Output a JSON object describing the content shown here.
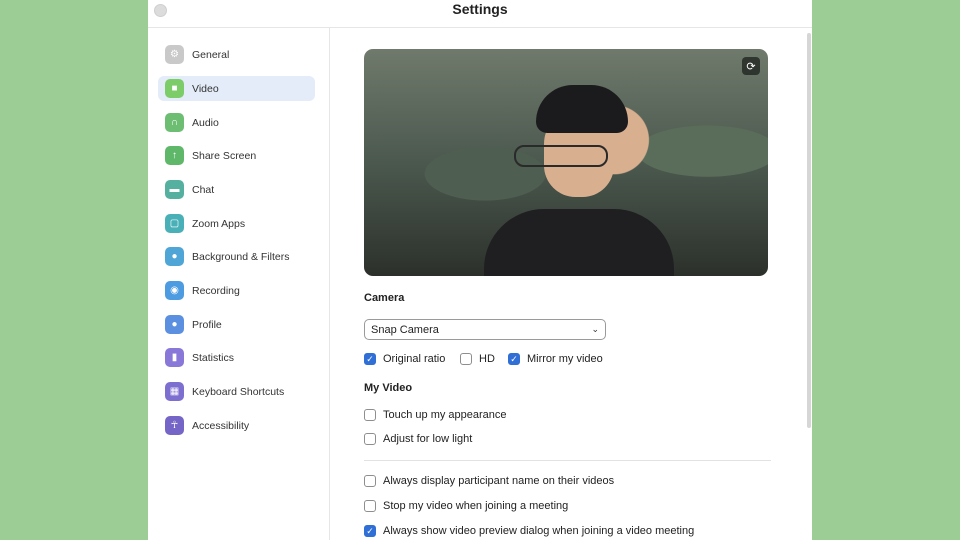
{
  "window": {
    "title": "Settings"
  },
  "sidebar": {
    "items": [
      {
        "label": "General",
        "icon": "gear-icon",
        "color": "#c9c9c9"
      },
      {
        "label": "Video",
        "icon": "video-camera-icon",
        "color": "#7ccd6a"
      },
      {
        "label": "Audio",
        "icon": "headphones-icon",
        "color": "#6dbd73"
      },
      {
        "label": "Share Screen",
        "icon": "share-screen-icon",
        "color": "#5fb86a"
      },
      {
        "label": "Chat",
        "icon": "chat-bubble-icon",
        "color": "#55b0a0"
      },
      {
        "label": "Zoom Apps",
        "icon": "zoom-apps-icon",
        "color": "#4ab0b7"
      },
      {
        "label": "Background & Filters",
        "icon": "person-background-icon",
        "color": "#4fa6d6"
      },
      {
        "label": "Recording",
        "icon": "record-icon",
        "color": "#4d9be0"
      },
      {
        "label": "Profile",
        "icon": "profile-icon",
        "color": "#5b8fe0"
      },
      {
        "label": "Statistics",
        "icon": "bar-chart-icon",
        "color": "#8a78d8"
      },
      {
        "label": "Keyboard Shortcuts",
        "icon": "keyboard-icon",
        "color": "#7d6fcf"
      },
      {
        "label": "Accessibility",
        "icon": "accessibility-icon",
        "color": "#7465c6"
      }
    ],
    "active_index": 1
  },
  "video": {
    "camera_heading": "Camera",
    "camera_select": "Snap Camera",
    "options": [
      {
        "label": "Original ratio",
        "checked": true
      },
      {
        "label": "HD",
        "checked": false
      },
      {
        "label": "Mirror my video",
        "checked": true
      }
    ],
    "my_video_heading": "My Video",
    "my_video_options": [
      {
        "label": "Touch up my appearance",
        "checked": false
      },
      {
        "label": "Adjust for low light",
        "checked": false
      }
    ],
    "more_options": [
      {
        "label": "Always display participant name on their videos",
        "checked": false
      },
      {
        "label": "Stop my video when joining a meeting",
        "checked": false
      },
      {
        "label": "Always show video preview dialog when joining a video meeting",
        "checked": true
      }
    ]
  },
  "colors": {
    "accent": "#2f6fd6",
    "active_bg": "#e3ecf8",
    "page_bg": "#9bcd94"
  }
}
